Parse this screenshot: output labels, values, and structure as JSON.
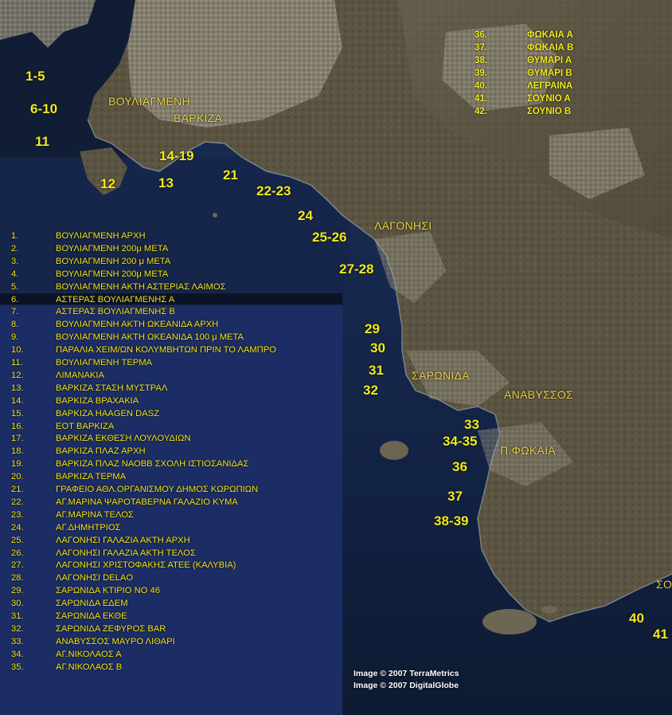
{
  "legend_left": [
    {
      "num": "1.",
      "name": "ΒΟΥΛΙΑΓΜΕΝΗ ΑΡΧΗ"
    },
    {
      "num": "2.",
      "name": "ΒΟΥΛΙΑΓΜΕΝΗ 200μ ΜΕΤΑ"
    },
    {
      "num": "3.",
      "name": "ΒΟΥΛΙΑΓΜΕΝΗ 200 μ ΜΕΤΑ"
    },
    {
      "num": "4.",
      "name": "ΒΟΥΛΙΑΓΜΕΝΗ 200μ ΜΕΤΑ"
    },
    {
      "num": "5.",
      "name": "ΒΟΥΛΙΑΓΜΕΝΗ ΑΚΤΗ ΑΣΤΕΡΙΑΣ ΛΑΙΜΟΣ"
    },
    {
      "num": "6.",
      "name": "ΑΣΤΕΡΑΣ ΒΟΥΛΙΑΓΜΕΝΗΣ Α"
    },
    {
      "num": "7.",
      "name": "ΑΣΤΕΡΑΣ ΒΟΥΛΙΑΓΜΕΝΗΣ Β"
    },
    {
      "num": "8.",
      "name": "ΒΟΥΛΙΑΓΜΕΝΗ ΑΚΤΗ ΩΚΕΑΝΙΔΑ ΑΡΧΗ"
    },
    {
      "num": "9.",
      "name": "ΒΟΥΛΙΑΓΜΕΝΗ ΑΚΤΗ ΩΚΕΑΝΙΔΑ 100 μ ΜΕΤΑ"
    },
    {
      "num": "10.",
      "name": "ΠΑΡΑΛΙΑ ΧΕΙΜ/ΩΝ ΚΟΛΥΜΒΗΤΩΝ ΠΡΙΝ ΤΟ ΛΑΜΠΡΟ"
    },
    {
      "num": "11.",
      "name": "ΒΟΥΛΙΑΓΜΕΝΗ ΤΕΡΜΑ"
    },
    {
      "num": "12.",
      "name": "ΛΙΜΑΝΑΚΙΑ"
    },
    {
      "num": "13.",
      "name": "ΒΑΡΚΙΖΑ ΣΤΑΣΗ ΜΥΣΤΡΑΛ"
    },
    {
      "num": "14.",
      "name": "ΒΑΡΚΙΖΑ ΒΡΑΧΑΚΙΑ"
    },
    {
      "num": "15.",
      "name": "ΒΑΡΚΙΖΑ HAAGEN DASZ"
    },
    {
      "num": "16.",
      "name": "ΕΟΤ ΒΑΡΚΙΖΑ"
    },
    {
      "num": "17.",
      "name": "ΒΑΡΚΙΖΑ ΕΚΘΕΣΗ ΛΟΥΛΟΥΔΙΩΝ"
    },
    {
      "num": "18.",
      "name": "ΒΑΡΚΙΖΑ ΠΛΑΖ ΑΡΧΗ"
    },
    {
      "num": "19.",
      "name": "ΒΑΡΚΙΖΑ ΠΛΑΖ ΝΑΟΒΒ ΣΧΟΛΗ ΙΣΤΙΟΣΑΝΙΔΑΣ"
    },
    {
      "num": "20.",
      "name": "ΒΑΡΚΙΖΑ ΤΕΡΜΑ"
    },
    {
      "num": "21.",
      "name": "ΓΡΑΦΕΙΟ ΑΘΛ.ΟΡΓΑΝΙΣΜΟΥ ΔΗΜΟΣ ΚΩΡΩΠΙΩΝ"
    },
    {
      "num": "22.",
      "name": "ΑΓ.ΜΑΡΙΝΑ ΨΑΡΟΤΑΒΕΡΝΑ ΓΑΛΑΖΙΟ ΚΥΜΑ"
    },
    {
      "num": "23.",
      "name": "ΑΓ.ΜΑΡΙΝΑ ΤΕΛΟΣ"
    },
    {
      "num": "24.",
      "name": "ΑΓ.ΔΗΜΗΤΡΙΟΣ"
    },
    {
      "num": "25.",
      "name": "ΛΑΓΟΝΗΣΙ ΓΑΛΑΖΙΑ ΑΚΤΗ ΑΡΧΗ"
    },
    {
      "num": "26.",
      "name": "ΛΑΓΟΝΗΣΙ ΓΑΛΑΖΙΑ ΑΚΤΗ ΤΕΛΟΣ"
    },
    {
      "num": "27.",
      "name": "ΛΑΓΟΝΗΣΙ ΧΡΙΣΤΟΦΑΚΗΣ ΑΤΕΕ (ΚΑΛΥΒΙΑ)"
    },
    {
      "num": "28.",
      "name": "ΛΑΓΟΝΗΣΙ DELAO"
    },
    {
      "num": "29.",
      "name": "ΣΑΡΩΝΙΔΑ ΚΤΙΡΙΟ ΝΟ 46"
    },
    {
      "num": "30.",
      "name": "ΣΑΡΩΝΙΔΑ ΕΔΕΜ"
    },
    {
      "num": "31.",
      "name": "ΣΑΡΩΝΙΔΑ ΕΚΘΕ"
    },
    {
      "num": "32.",
      "name": "ΣΑΡΩΝΙΔΑ ΖΕΦΥΡΟΣ BAR"
    },
    {
      "num": "33.",
      "name": "ΑΝΑΒΥΣΣΟΣ ΜΑΥΡΟ ΛΙΘΑΡΙ"
    },
    {
      "num": "34.",
      "name": "ΑΓ.ΝΙΚΟΛΑΟΣ Α"
    },
    {
      "num": "35.",
      "name": "ΑΓ.ΝΙΚΟΛΑΟΣ Β"
    }
  ],
  "legend_right": [
    {
      "num": "36.",
      "name": "ΦΩΚΑΙΑ Α"
    },
    {
      "num": "37.",
      "name": "ΦΩΚΑΙΑ Β"
    },
    {
      "num": "38.",
      "name": "ΘΥΜΑΡΙ Α"
    },
    {
      "num": "39.",
      "name": "ΘΥΜΑΡΙ Β"
    },
    {
      "num": "40.",
      "name": "ΛΕΓΡΑΙΝΑ"
    },
    {
      "num": "41.",
      "name": "ΣΟΥΝΙΟ Α"
    },
    {
      "num": "42.",
      "name": "ΣΟΥΝΙΟ Β"
    }
  ],
  "place_names": {
    "vouliagmeni": "ΒΟΥΛΙΑΓΜΕΝΗ",
    "varkiza": "ΒΑΡΚΙΖΑ",
    "lagonisi": "ΛΑΓΟΝΗΣΙ",
    "saronida": "ΣΑΡΩΝΙΔΑ",
    "anavyssos": "ΑΝΑΒΥΣΣΟΣ",
    "p_fokaia": "Π.ΦΩΚΑΙΑ",
    "sounio_partial": "ΣΟ"
  },
  "markers": {
    "m1_5": "1-5",
    "m6_10": "6-10",
    "m11": "11",
    "m12": "12",
    "m13": "13",
    "m14_19": "14-19",
    "m21": "21",
    "m22_23": "22-23",
    "m24": "24",
    "m25_26": "25-26",
    "m27_28": "27-28",
    "m29": "29",
    "m30": "30",
    "m31": "31",
    "m32": "32",
    "m33": "33",
    "m34_35": "34-35",
    "m36": "36",
    "m37": "37",
    "m38_39": "38-39",
    "m40": "40",
    "m41": "41"
  },
  "credits": {
    "line1": "Image © 2007 TerraMetrics",
    "line2": "Image © 2007 DigitalGlobe"
  },
  "colors": {
    "label_yellow": "#f2ea1c",
    "sea_dark": "#0e1f3c",
    "land": "#5e5644"
  }
}
